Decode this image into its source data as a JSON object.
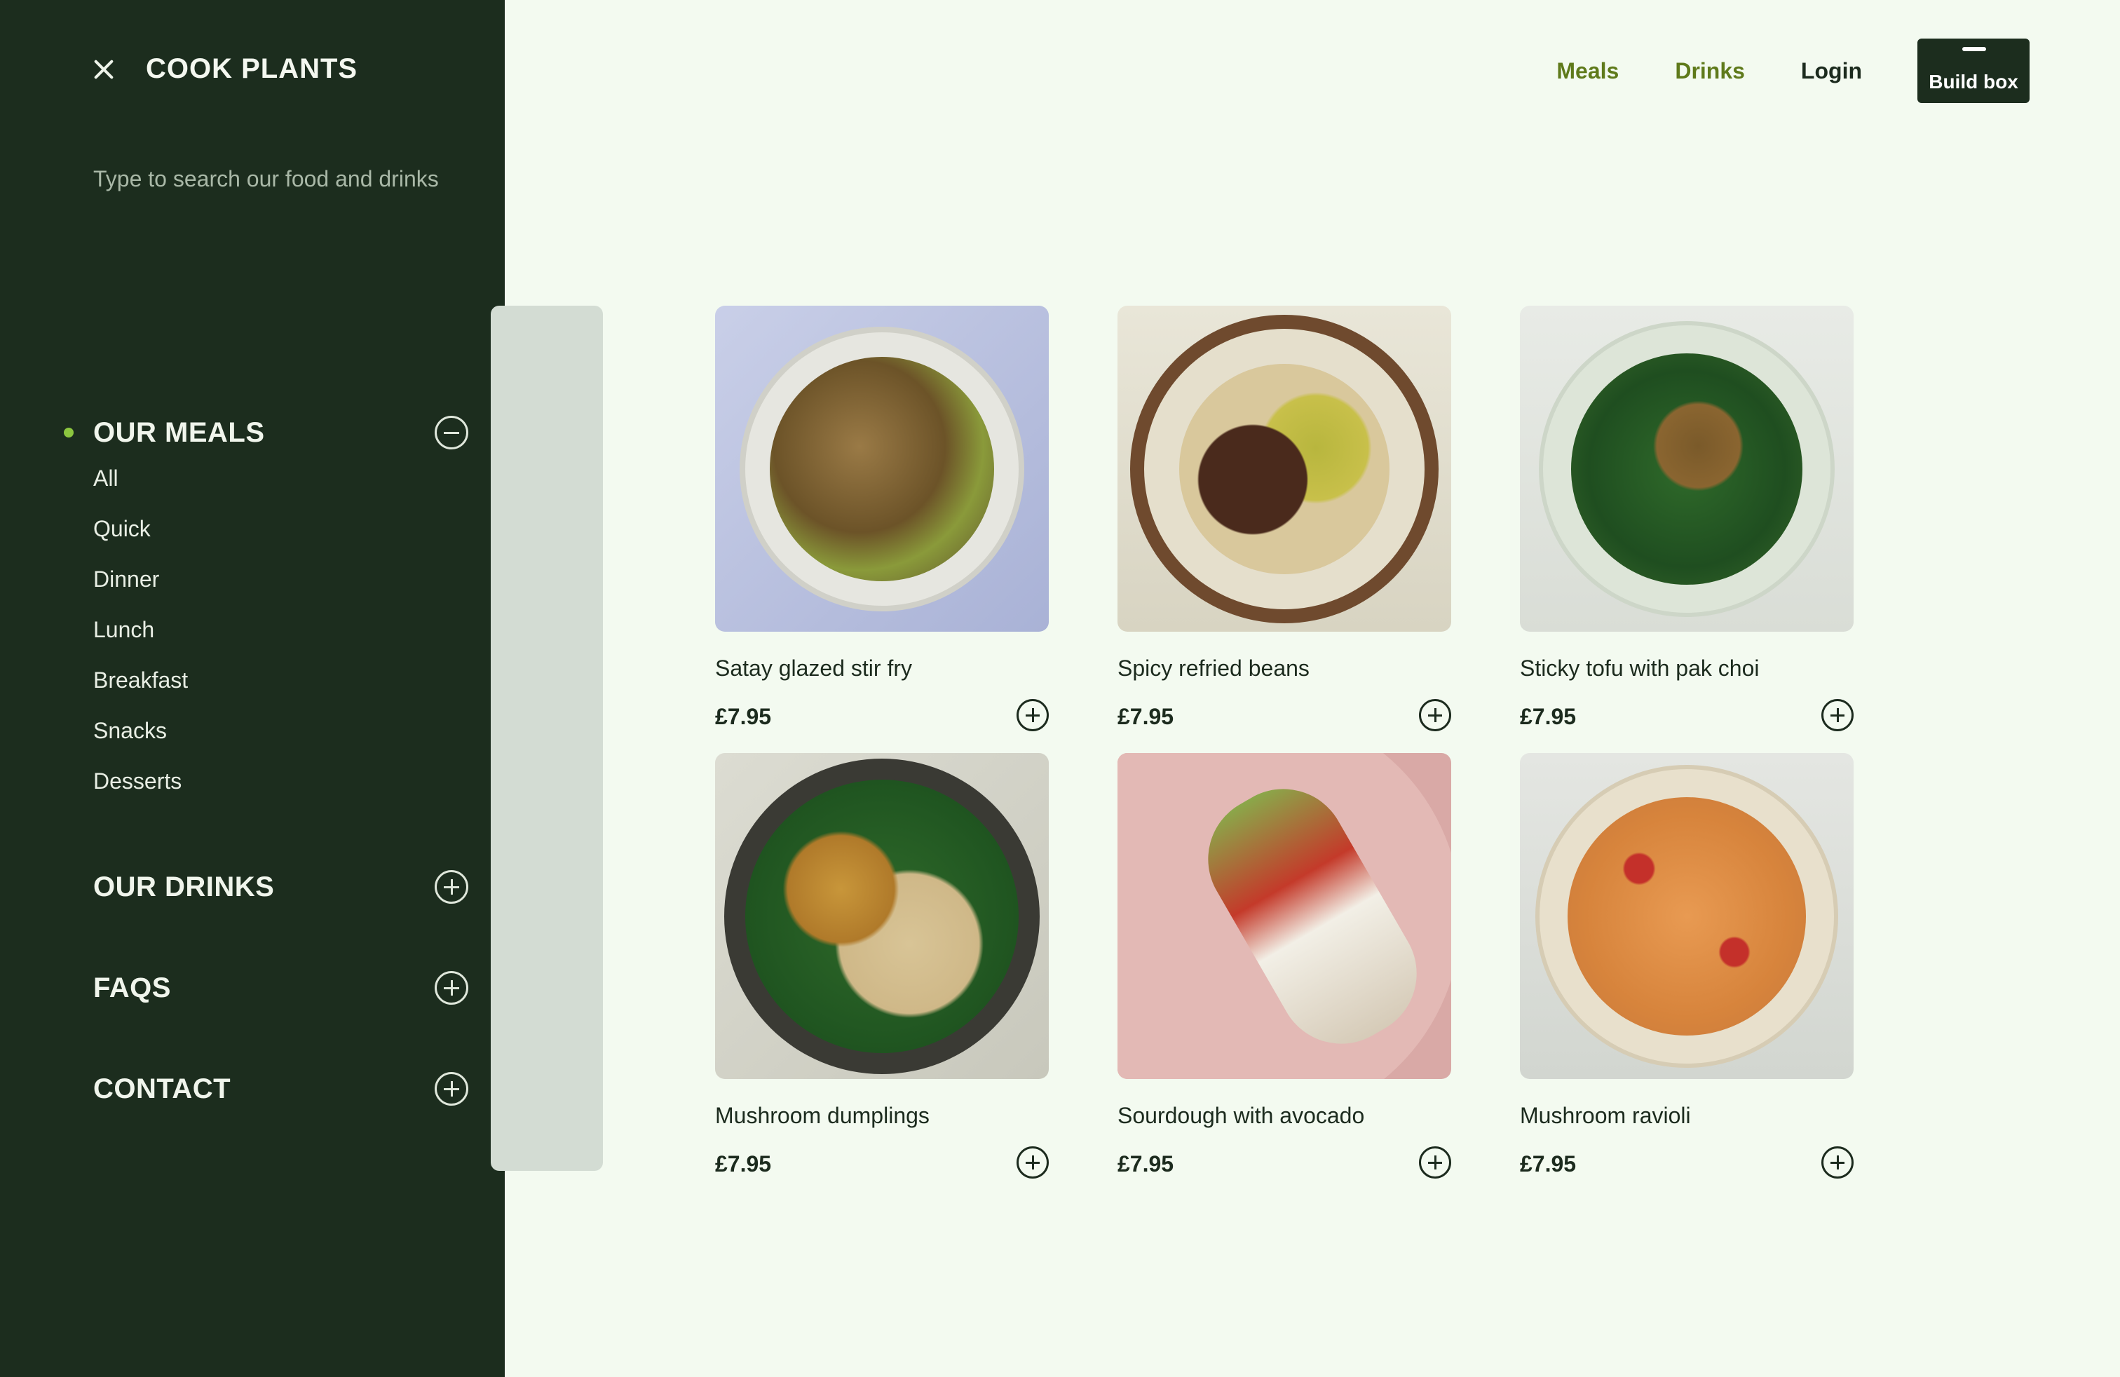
{
  "sidebar": {
    "brand": "COOK PLANTS",
    "search_placeholder": "Type to search our food and drinks",
    "sections": [
      {
        "title": "OUR MEALS",
        "expanded": true,
        "items": [
          "All",
          "Quick",
          "Dinner",
          "Lunch",
          "Breakfast",
          "Snacks",
          "Desserts"
        ]
      },
      {
        "title": "OUR DRINKS",
        "expanded": false
      },
      {
        "title": "FAQS",
        "expanded": false
      },
      {
        "title": "CONTACT",
        "expanded": false
      }
    ]
  },
  "top_nav": {
    "meals": "Meals",
    "drinks": "Drinks",
    "login": "Login",
    "build_box": "Build box"
  },
  "meals": [
    {
      "name": "Satay glazed stir fry",
      "price": "£7.95"
    },
    {
      "name": "Spicy refried beans",
      "price": "£7.95"
    },
    {
      "name": "Sticky tofu with pak choi",
      "price": "£7.95"
    },
    {
      "name": "Mushroom dumplings",
      "price": "£7.95"
    },
    {
      "name": "Sourdough with avocado",
      "price": "£7.95"
    },
    {
      "name": "Mushroom ravioli",
      "price": "£7.95"
    }
  ],
  "colors": {
    "sidebar_bg": "#1c2d1e",
    "page_bg": "#f3faf0",
    "accent_olive": "#5f7a1b",
    "bullet_green": "#8cc63f"
  }
}
